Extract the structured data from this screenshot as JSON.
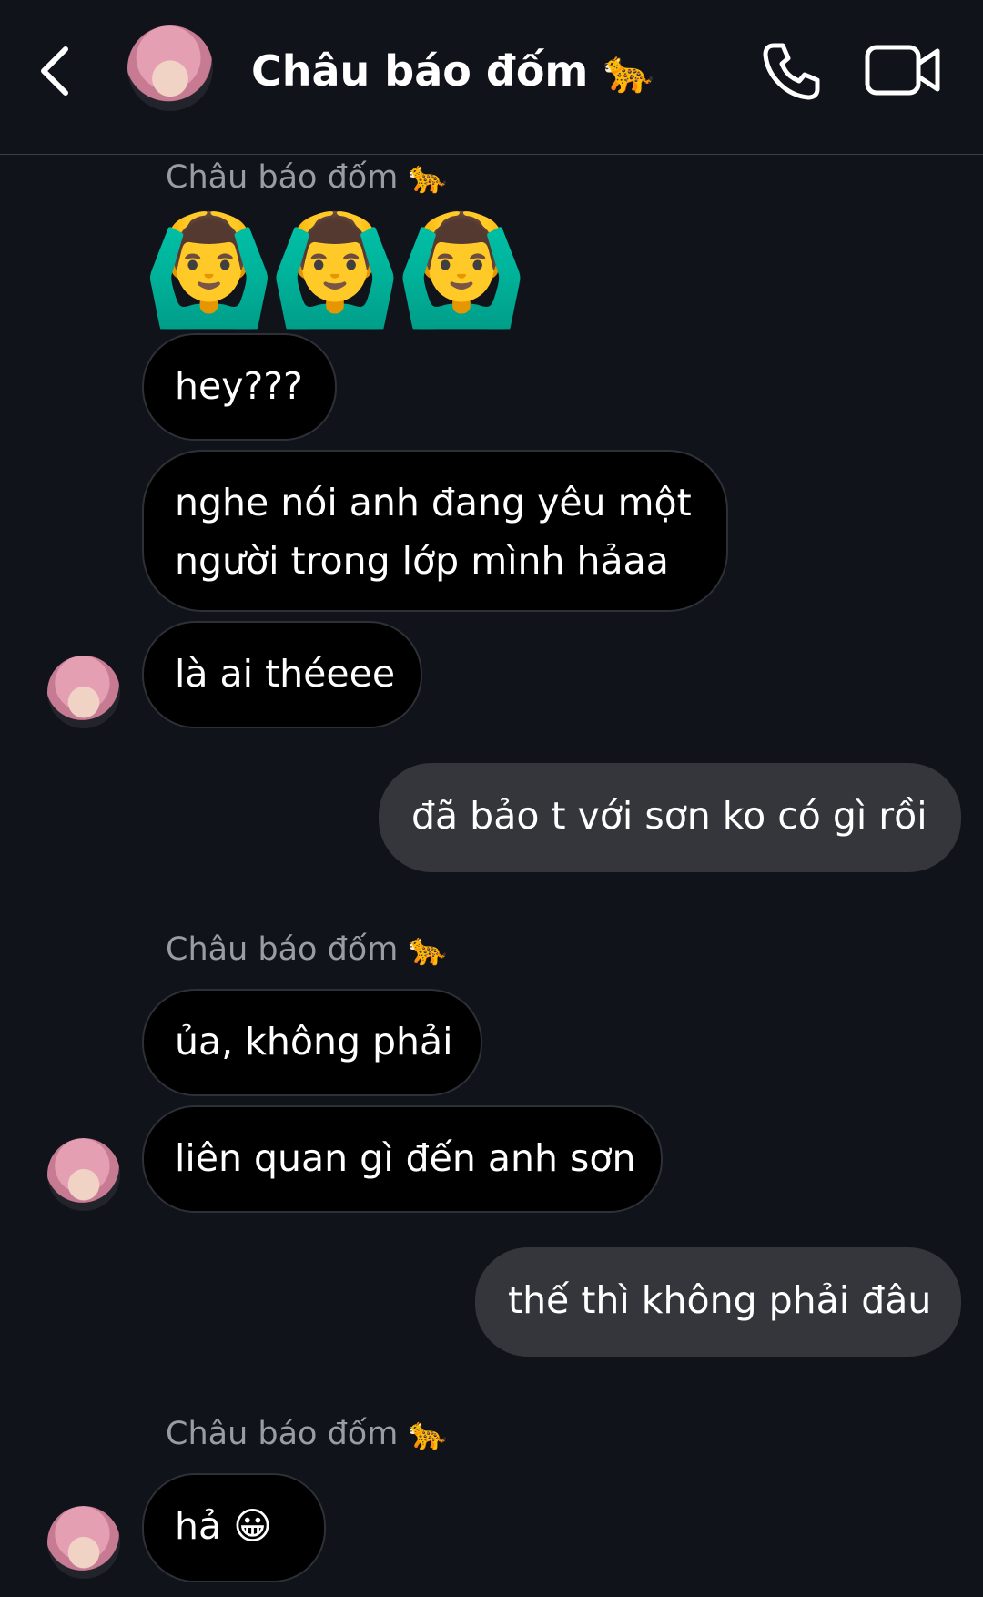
{
  "header": {
    "contact_name": "Châu báo đốm 🐆"
  },
  "messages": [
    {
      "type": "sender",
      "text": "Châu báo đốm 🐆"
    },
    {
      "type": "emoji",
      "text": "🙆‍♂️🙆‍♂️🙆‍♂️"
    },
    {
      "type": "in",
      "text": "hey???"
    },
    {
      "type": "in",
      "line1": "nghe nói anh đang yêu một",
      "line2": "người trong lớp mình hảaa"
    },
    {
      "type": "in",
      "text": "là ai théeee"
    },
    {
      "type": "out",
      "text": "đã bảo t với sơn ko có gì rồi"
    },
    {
      "type": "sender",
      "text": "Châu báo đốm 🐆"
    },
    {
      "type": "in",
      "text": "ủa, không phải"
    },
    {
      "type": "in",
      "text": "liên quan gì đến anh sơn"
    },
    {
      "type": "out",
      "text": "thế thì không phải đâu"
    },
    {
      "type": "sender",
      "text": "Châu báo đốm 🐆"
    },
    {
      "type": "in",
      "text": "hả 😀"
    }
  ],
  "icons": {
    "back": "chevron-left-icon",
    "call": "phone-icon",
    "video": "video-camera-icon"
  }
}
